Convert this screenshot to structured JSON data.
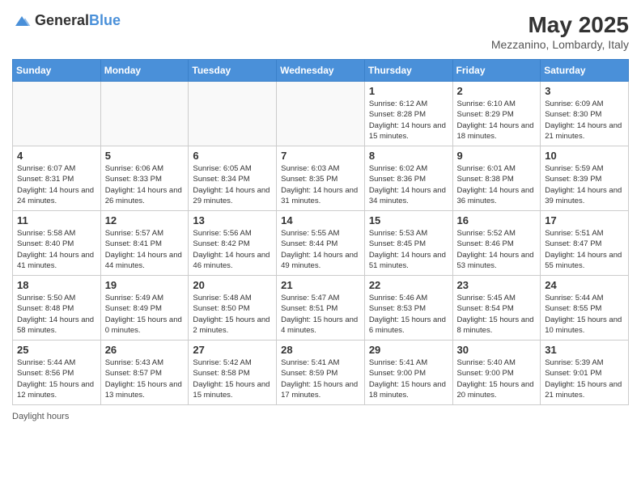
{
  "logo": {
    "general": "General",
    "blue": "Blue"
  },
  "title": {
    "month_year": "May 2025",
    "location": "Mezzanino, Lombardy, Italy"
  },
  "days_of_week": [
    "Sunday",
    "Monday",
    "Tuesday",
    "Wednesday",
    "Thursday",
    "Friday",
    "Saturday"
  ],
  "weeks": [
    [
      {
        "day": "",
        "info": ""
      },
      {
        "day": "",
        "info": ""
      },
      {
        "day": "",
        "info": ""
      },
      {
        "day": "",
        "info": ""
      },
      {
        "day": "1",
        "info": "Sunrise: 6:12 AM\nSunset: 8:28 PM\nDaylight: 14 hours and 15 minutes."
      },
      {
        "day": "2",
        "info": "Sunrise: 6:10 AM\nSunset: 8:29 PM\nDaylight: 14 hours and 18 minutes."
      },
      {
        "day": "3",
        "info": "Sunrise: 6:09 AM\nSunset: 8:30 PM\nDaylight: 14 hours and 21 minutes."
      }
    ],
    [
      {
        "day": "4",
        "info": "Sunrise: 6:07 AM\nSunset: 8:31 PM\nDaylight: 14 hours and 24 minutes."
      },
      {
        "day": "5",
        "info": "Sunrise: 6:06 AM\nSunset: 8:33 PM\nDaylight: 14 hours and 26 minutes."
      },
      {
        "day": "6",
        "info": "Sunrise: 6:05 AM\nSunset: 8:34 PM\nDaylight: 14 hours and 29 minutes."
      },
      {
        "day": "7",
        "info": "Sunrise: 6:03 AM\nSunset: 8:35 PM\nDaylight: 14 hours and 31 minutes."
      },
      {
        "day": "8",
        "info": "Sunrise: 6:02 AM\nSunset: 8:36 PM\nDaylight: 14 hours and 34 minutes."
      },
      {
        "day": "9",
        "info": "Sunrise: 6:01 AM\nSunset: 8:38 PM\nDaylight: 14 hours and 36 minutes."
      },
      {
        "day": "10",
        "info": "Sunrise: 5:59 AM\nSunset: 8:39 PM\nDaylight: 14 hours and 39 minutes."
      }
    ],
    [
      {
        "day": "11",
        "info": "Sunrise: 5:58 AM\nSunset: 8:40 PM\nDaylight: 14 hours and 41 minutes."
      },
      {
        "day": "12",
        "info": "Sunrise: 5:57 AM\nSunset: 8:41 PM\nDaylight: 14 hours and 44 minutes."
      },
      {
        "day": "13",
        "info": "Sunrise: 5:56 AM\nSunset: 8:42 PM\nDaylight: 14 hours and 46 minutes."
      },
      {
        "day": "14",
        "info": "Sunrise: 5:55 AM\nSunset: 8:44 PM\nDaylight: 14 hours and 49 minutes."
      },
      {
        "day": "15",
        "info": "Sunrise: 5:53 AM\nSunset: 8:45 PM\nDaylight: 14 hours and 51 minutes."
      },
      {
        "day": "16",
        "info": "Sunrise: 5:52 AM\nSunset: 8:46 PM\nDaylight: 14 hours and 53 minutes."
      },
      {
        "day": "17",
        "info": "Sunrise: 5:51 AM\nSunset: 8:47 PM\nDaylight: 14 hours and 55 minutes."
      }
    ],
    [
      {
        "day": "18",
        "info": "Sunrise: 5:50 AM\nSunset: 8:48 PM\nDaylight: 14 hours and 58 minutes."
      },
      {
        "day": "19",
        "info": "Sunrise: 5:49 AM\nSunset: 8:49 PM\nDaylight: 15 hours and 0 minutes."
      },
      {
        "day": "20",
        "info": "Sunrise: 5:48 AM\nSunset: 8:50 PM\nDaylight: 15 hours and 2 minutes."
      },
      {
        "day": "21",
        "info": "Sunrise: 5:47 AM\nSunset: 8:51 PM\nDaylight: 15 hours and 4 minutes."
      },
      {
        "day": "22",
        "info": "Sunrise: 5:46 AM\nSunset: 8:53 PM\nDaylight: 15 hours and 6 minutes."
      },
      {
        "day": "23",
        "info": "Sunrise: 5:45 AM\nSunset: 8:54 PM\nDaylight: 15 hours and 8 minutes."
      },
      {
        "day": "24",
        "info": "Sunrise: 5:44 AM\nSunset: 8:55 PM\nDaylight: 15 hours and 10 minutes."
      }
    ],
    [
      {
        "day": "25",
        "info": "Sunrise: 5:44 AM\nSunset: 8:56 PM\nDaylight: 15 hours and 12 minutes."
      },
      {
        "day": "26",
        "info": "Sunrise: 5:43 AM\nSunset: 8:57 PM\nDaylight: 15 hours and 13 minutes."
      },
      {
        "day": "27",
        "info": "Sunrise: 5:42 AM\nSunset: 8:58 PM\nDaylight: 15 hours and 15 minutes."
      },
      {
        "day": "28",
        "info": "Sunrise: 5:41 AM\nSunset: 8:59 PM\nDaylight: 15 hours and 17 minutes."
      },
      {
        "day": "29",
        "info": "Sunrise: 5:41 AM\nSunset: 9:00 PM\nDaylight: 15 hours and 18 minutes."
      },
      {
        "day": "30",
        "info": "Sunrise: 5:40 AM\nSunset: 9:00 PM\nDaylight: 15 hours and 20 minutes."
      },
      {
        "day": "31",
        "info": "Sunrise: 5:39 AM\nSunset: 9:01 PM\nDaylight: 15 hours and 21 minutes."
      }
    ]
  ],
  "footer": {
    "label": "Daylight hours"
  }
}
